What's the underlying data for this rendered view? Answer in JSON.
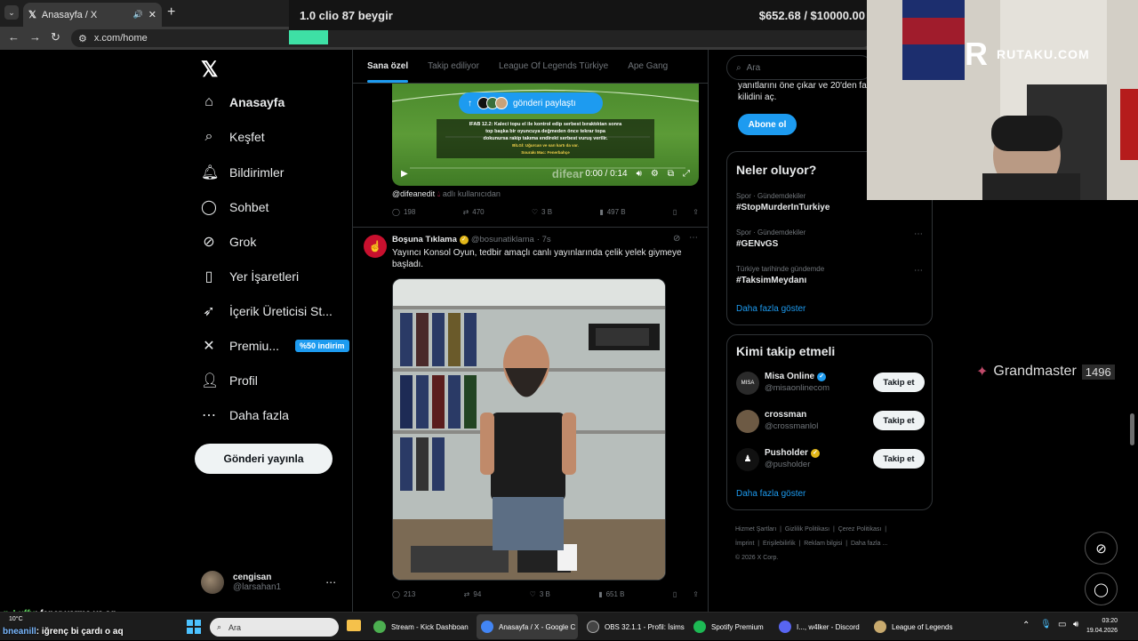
{
  "browser": {
    "tab_title": "Anasayfa / X",
    "url": "x.com/home"
  },
  "overlay": {
    "left_text": "1.0 clio 87 beygir",
    "right_text": "$652.68 / $10000.00"
  },
  "nav": {
    "items": [
      {
        "label": "Anasayfa",
        "icon": "home-icon"
      },
      {
        "label": "Keşfet",
        "icon": "search-icon"
      },
      {
        "label": "Bildirimler",
        "icon": "bell-icon"
      },
      {
        "label": "Sohbet",
        "icon": "chat-icon"
      },
      {
        "label": "Grok",
        "icon": "grok-icon"
      },
      {
        "label": "Yer İşaretleri",
        "icon": "bookmark-icon"
      },
      {
        "label": "İçerik Üreticisi St...",
        "icon": "rocket-icon"
      },
      {
        "label": "Premiu...",
        "icon": "x-icon"
      },
      {
        "label": "Profil",
        "icon": "person-icon"
      },
      {
        "label": "Daha fazla",
        "icon": "more-circle-icon"
      }
    ],
    "premium_badge": "%50 indirim",
    "post_button": "Gönderi yayınla",
    "account": {
      "name": "cengisan",
      "handle": "@larsahan1"
    }
  },
  "feed": {
    "tabs": [
      "Sana özel",
      "Takip ediliyor",
      "League Of Legends Türkiye",
      "Ape Gang"
    ],
    "video_post": {
      "share_pill": "gönderi paylaştı",
      "caption_line1": "IFAB 12.2: Kaleci topu el ile kontrol edip serbest bıraktıktan sonra",
      "caption_line2": "top başka bir oyuncuya değmeden önce tekrar topa",
      "caption_line3": "dokunursa rakip takıma endirekt serbest vuruş verilir.",
      "caption_small": "BİLGİ: Uğurcan ve sarı kartı da var.",
      "caption_small2": "Sourakı Mac: Fenerbahçe",
      "watermark": "difear",
      "time": "0:00 / 0:14",
      "credit_user": "@difeanedit",
      "credit_text": "adlı kullanıcıdan",
      "stats": {
        "replies": "198",
        "reposts": "470",
        "likes": "3 B",
        "views": "497 B"
      }
    },
    "post": {
      "name": "Boşuna Tıklama",
      "handle": "@bosunatiklama",
      "time": "· 7s",
      "text": "Yayıncı Konsol Oyun, tedbir amaçlı canlı yayınlarında çelik yelek giymeye başladı.",
      "stats": {
        "replies": "213",
        "reposts": "94",
        "likes": "3 B",
        "views": "651 B"
      }
    }
  },
  "sidebar": {
    "search_placeholder": "Ara",
    "premium_text": "yanıtlarını öne çıkar ve 20'den fa kilidini aç.",
    "premium_button": "Abone ol",
    "trends_title": "Neler oluyor?",
    "trends": [
      {
        "meta": "Spor · Gündemdekiler",
        "name": "#StopMurderInTurkiye"
      },
      {
        "meta": "Spor · Gündemdekiler",
        "name": "#GENvGS"
      },
      {
        "meta": "Türkiye tarihinde gündemde",
        "name": "#TaksimMeydanı"
      }
    ],
    "trends_more": "Daha fazla göster",
    "follow_title": "Kimi takip etmeli",
    "follow": [
      {
        "name": "Misa Online",
        "handle": "@misaonlinecom",
        "button": "Takip et",
        "badge": "blue",
        "avatar_color": "#2a2a2a"
      },
      {
        "name": "crossman",
        "handle": "@crossmanlol",
        "button": "Takip et",
        "badge": "",
        "avatar_color": "#6d5a44"
      },
      {
        "name": "Pusholder",
        "handle": "@pusholder",
        "button": "Takip et",
        "badge": "gold",
        "avatar_color": "#111"
      }
    ],
    "follow_more": "Daha fazla göster",
    "footer": [
      "Hizmet Şartları",
      "Gizlilik Politikası",
      "Çerez Politikası",
      "İmprint",
      "Erişilebilirlik",
      "Reklam bilgisi",
      "Daha fazla ...",
      "© 2026 X Corp."
    ]
  },
  "stream": {
    "brand": "RUTAKU.COM",
    "rank": "Grandmaster",
    "rank_points": "1496",
    "chat": [
      {
        "user": "q_Luffy",
        "text": ": fener yarma ya aq"
      },
      {
        "user": "bneanill",
        "text": ": iğrenç bi çardı o aq"
      }
    ]
  },
  "taskbar": {
    "weather": "10°C",
    "search_placeholder": "Ara",
    "apps": [
      {
        "label": "Stream - Kick Dashboan",
        "color": "#4caf50"
      },
      {
        "label": "Anasayfa / X - Google C",
        "color": "#4285f4"
      },
      {
        "label": "OBS 32.1.1 - Profil: İsims",
        "color": "#444"
      },
      {
        "label": "Spotify Premium",
        "color": "#1db954"
      },
      {
        "label": "I..., w4lker - Discord",
        "color": "#5865f2"
      },
      {
        "label": "League of Legends",
        "color": "#c8aa6e"
      }
    ],
    "time": "03:20",
    "date": "19.04.2026"
  }
}
